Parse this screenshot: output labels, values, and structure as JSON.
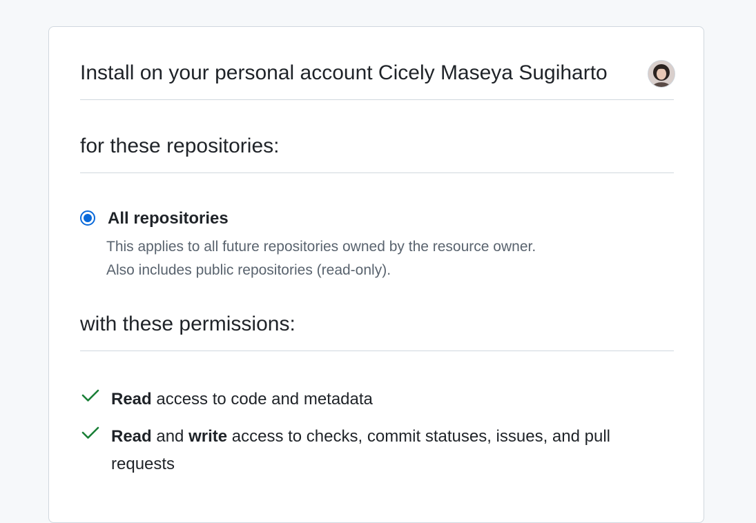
{
  "install": {
    "title": "Install on your personal account Cicely Maseya Sugiharto",
    "avatar_icon": "user-avatar"
  },
  "repositories": {
    "heading": "for these repositories:",
    "option": {
      "label": "All repositories",
      "selected": true,
      "desc_line1": "This applies to all future repositories owned by the resource owner.",
      "desc_line2": "Also includes public repositories (read-only)."
    }
  },
  "permissions": {
    "heading": "with these permissions:",
    "items": [
      {
        "icon": "check-icon",
        "strong1": "Read",
        "text1": " access to code and metadata"
      },
      {
        "icon": "check-icon",
        "strong1": "Read",
        "text1": " and ",
        "strong2": "write",
        "text2": " access to checks, commit statuses, issues, and pull requests"
      }
    ]
  },
  "colors": {
    "accent": "#0969da",
    "success": "#1a7f37",
    "border": "#d0d7de",
    "muted_text": "#59636e"
  }
}
